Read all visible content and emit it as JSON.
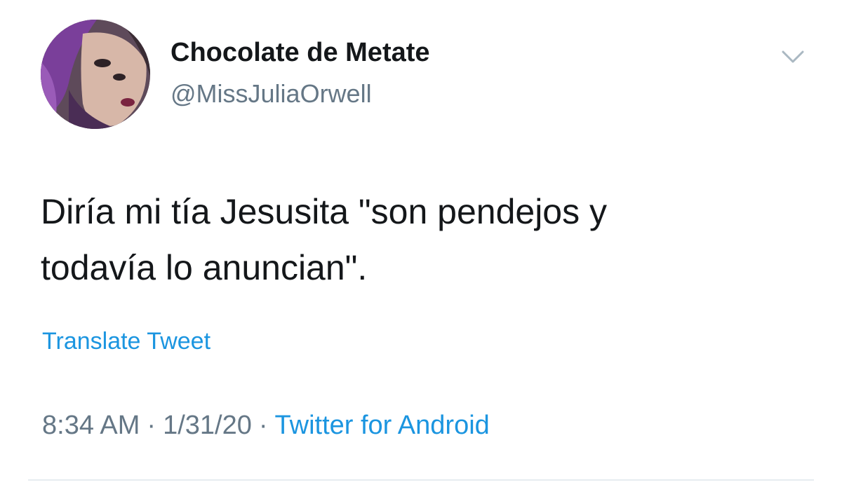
{
  "user": {
    "display_name": "Chocolate de Metate",
    "handle": "@MissJuliaOrwell"
  },
  "tweet": {
    "text_line_1": "Diría mi tía Jesusita \"son pendejos y",
    "text_line_2": "todavía lo anuncian\".",
    "translate_label": "Translate Tweet",
    "time": "8:34 AM",
    "date": "1/31/20",
    "separator": "·",
    "source": "Twitter for Android"
  },
  "icons": {
    "menu": "chevron-down-icon",
    "avatar": "profile-photo"
  },
  "colors": {
    "text": "#14171a",
    "secondary": "#657786",
    "link": "#1b95e0"
  }
}
